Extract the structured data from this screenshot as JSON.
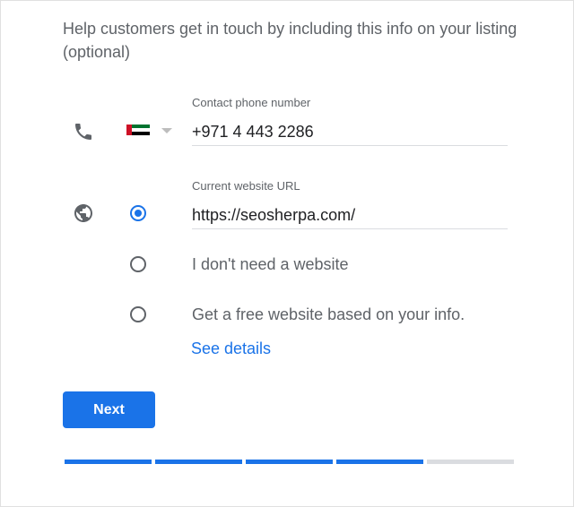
{
  "intro": {
    "text": "Help customers get in touch by including this info on your listing (optional)"
  },
  "phone": {
    "icon": "phone-icon",
    "country": "United Arab Emirates",
    "flag_colors": {
      "red": "#ce1126",
      "green": "#00732f",
      "white": "#ffffff",
      "black": "#000000"
    },
    "label": "Contact phone number",
    "value": "+971 4 443 2286"
  },
  "website": {
    "icon": "globe-icon",
    "label": "Current website URL",
    "value": "https://seosherpa.com/",
    "options": [
      {
        "label": "I don't need a website",
        "checked": false
      },
      {
        "label": "Get a free website based on your info.",
        "checked": false
      }
    ],
    "url_option_checked": true,
    "see_details": "See details"
  },
  "actions": {
    "next_label": "Next"
  },
  "progress": {
    "total_steps": 5,
    "completed_steps": 4
  },
  "colors": {
    "accent": "#1a73e8",
    "text_secondary": "#5f6368",
    "text_primary": "#202124",
    "progress_inactive": "#dadce0"
  }
}
